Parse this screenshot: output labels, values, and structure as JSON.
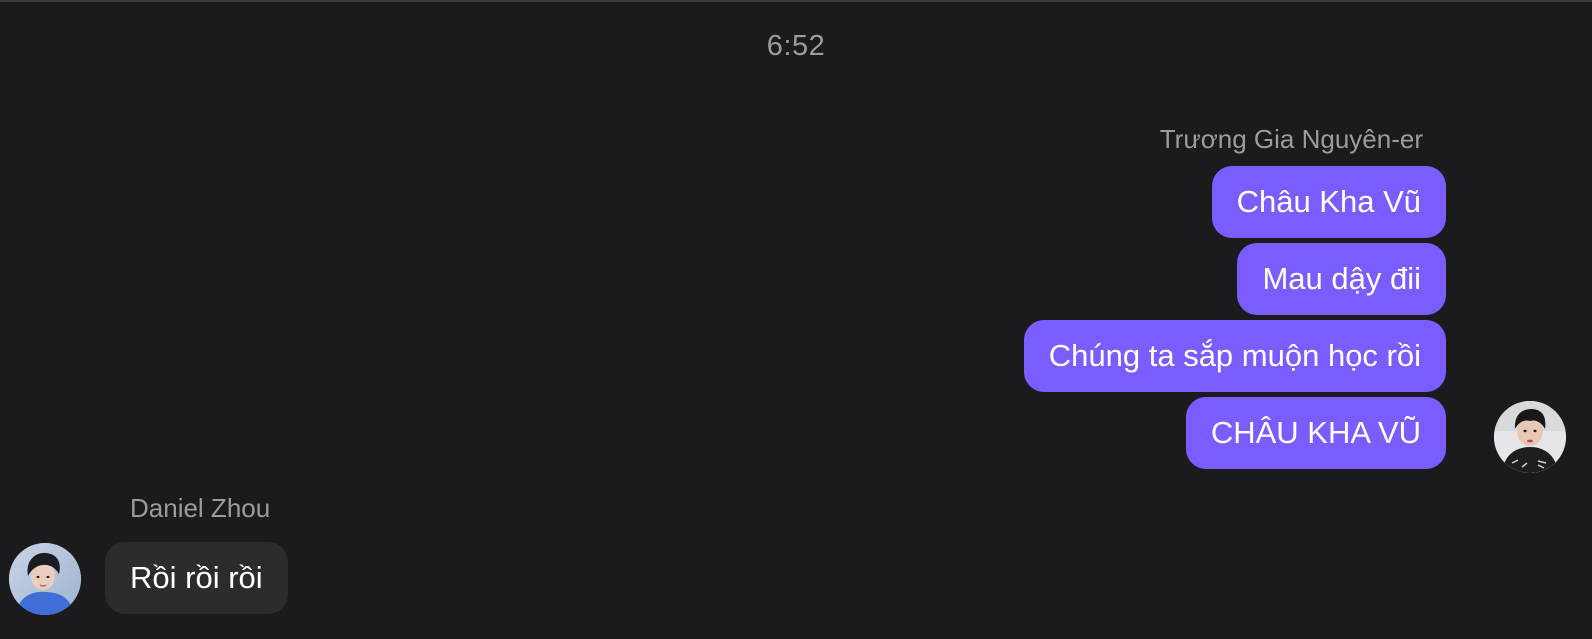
{
  "conversation": {
    "timestamp": "6:52"
  },
  "outgoing": {
    "sender_name": "Trương Gia Nguyên-er",
    "messages": [
      "Châu Kha Vũ",
      "Mau dậy đii",
      "Chúng ta sắp muộn học rồi",
      "CHÂU KHA VŨ"
    ],
    "avatar_icon": "user-avatar-photo",
    "bubble_color": "#7a5cff"
  },
  "incoming": {
    "sender_name": "Daniel Zhou",
    "messages": [
      "Rồi rồi rồi"
    ],
    "avatar_icon": "user-avatar-photo",
    "bubble_color": "#2c2c2f"
  },
  "theme": {
    "background": "#1b1b1d",
    "muted_text": "#9b9ba0"
  }
}
